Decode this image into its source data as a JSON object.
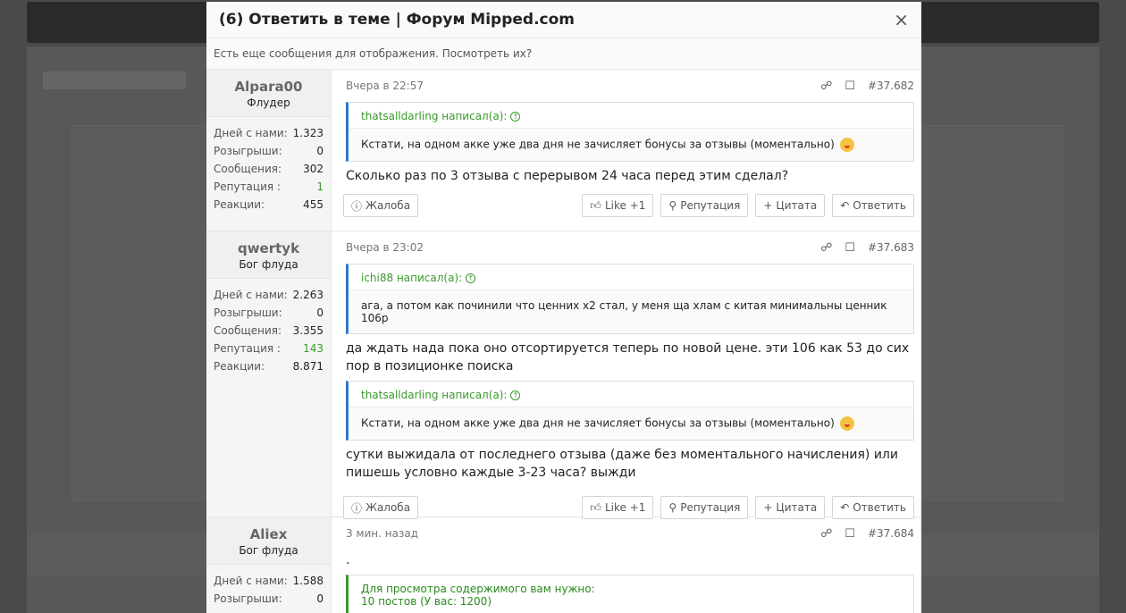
{
  "modal": {
    "title": "(6) Ответить в теме | Форум Mipped.com",
    "close": "×",
    "notice": "Есть еще сообщения для отображения. Посмотреть их?"
  },
  "labels": {
    "days": "Дней с нами:",
    "raffles": "Розыгрыши:",
    "messages": "Сообщения:",
    "reputation": "Репутация :",
    "reactions": "Реакции:",
    "complaint": "Жалоба",
    "like": "Like +1",
    "rep": "Репутация",
    "quote": "Цитата",
    "reply": "Ответить",
    "wrote": "написал(а):"
  },
  "posts": [
    {
      "user": "Alpara00",
      "rank": "Флудер",
      "days": "1.323",
      "raffles": "0",
      "messages": "302",
      "reputation": "1",
      "reactions": "455",
      "date": "Вчера в 22:57",
      "num": "#37.682",
      "quote_author": "thatsalldarling написал(а):",
      "quote_text": "Кстати, на одном акке уже два дня не зачисляет бонусы за отзывы (моментально)",
      "message": "Сколько раз по 3 отзыва с перерывом 24 часа перед этим сделал?"
    },
    {
      "user": "qwertyk",
      "rank": "Бог флуда",
      "days": "2.263",
      "raffles": "0",
      "messages": "3.355",
      "reputation": "143",
      "reactions": "8.871",
      "date": "Вчера в 23:02",
      "num": "#37.683",
      "quote_author": "ichi88 написал(а):",
      "quote_text": "ага, а потом как починили что ценних х2 стал, у меня ща хлам с китая минимальны ценник 106р",
      "message": "да ждать нада пока оно отсортируется теперь по новой цене. эти 106 как 53 до сих пор в позиционке поиска",
      "quote2_author": "thatsalldarling написал(а):",
      "quote2_text": "Кстати, на одном акке уже два дня не зачисляет бонусы за отзывы (моментально)",
      "message2": "сутки выжидала от последнего отзыва (даже без моментального начисления) или пишешь условно каждые 3-23 часа? выжди"
    },
    {
      "user": "Aliex",
      "rank": "Бог флуда",
      "days": "1.588",
      "raffles": "0",
      "date": "3 мин. назад",
      "num": "#37.684",
      "message": ".",
      "hidden_line1": "Для просмотра содержимого вам нужно:",
      "hidden_line2": "10 постов (У вас: 1200)"
    }
  ],
  "colors": {
    "quote_border": "#2f79c6",
    "green": "#3a9a2c"
  },
  "icons": [
    "close-icon",
    "share-icon",
    "bookmark-icon",
    "info-icon",
    "thumbs-up-icon",
    "search-icon",
    "plus-icon",
    "reply-icon",
    "arrow-up-circle-icon"
  ]
}
